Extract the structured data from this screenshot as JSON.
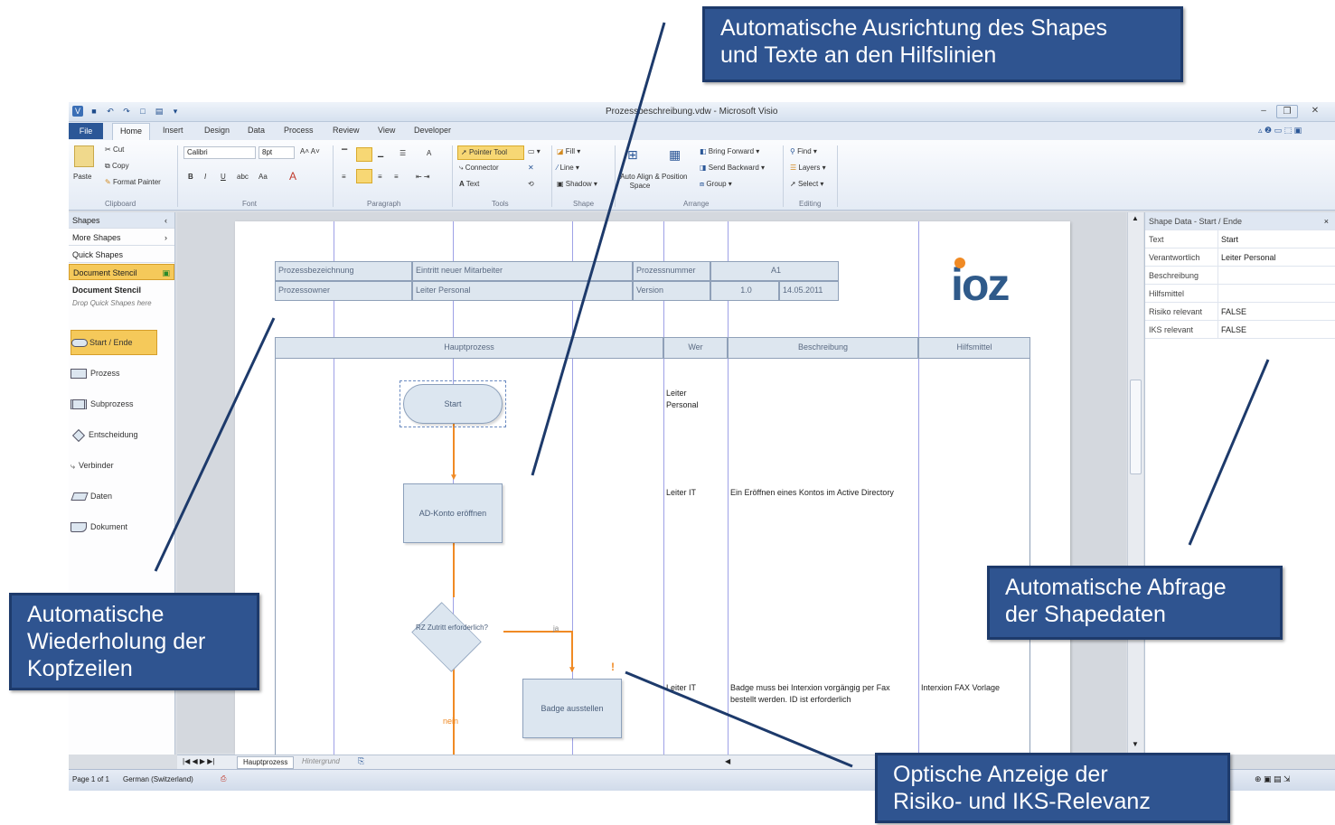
{
  "window": {
    "title": "Prozessbeschreibung.vdw - Microsoft Visio"
  },
  "menu": {
    "file": "File",
    "tabs": [
      "Home",
      "Insert",
      "Design",
      "Data",
      "Process",
      "Review",
      "View",
      "Developer"
    ]
  },
  "ribbon": {
    "clipboard": {
      "paste": "Paste",
      "cut": "Cut",
      "copy": "Copy",
      "format_painter": "Format Painter",
      "group": "Clipboard"
    },
    "font": {
      "family": "Calibri",
      "size": "8pt",
      "group": "Font"
    },
    "paragraph": {
      "group": "Paragraph"
    },
    "tools": {
      "pointer": "Pointer Tool",
      "connector": "Connector",
      "text": "Text",
      "group": "Tools"
    },
    "shape": {
      "fill": "Fill",
      "line": "Line",
      "shadow": "Shadow",
      "group": "Shape"
    },
    "arrange": {
      "auto_align": "Auto Align & Space",
      "position": "Position",
      "bring_forward": "Bring Forward",
      "send_backward": "Send Backward",
      "group_btn": "Group",
      "group": "Arrange"
    },
    "editing": {
      "find": "Find",
      "layers": "Layers",
      "select": "Select",
      "group": "Editing"
    }
  },
  "shapes_pane": {
    "title": "Shapes",
    "more_shapes": "More Shapes",
    "quick_shapes": "Quick Shapes",
    "document_stencil": "Document Stencil",
    "stencil_title": "Document Stencil",
    "stencil_hint": "Drop Quick Shapes here",
    "items": [
      "Start / Ende",
      "Prozess",
      "Subprozess",
      "Entscheidung",
      "Verbinder",
      "Daten",
      "Dokument"
    ]
  },
  "header_table": {
    "row1": [
      "Prozessbezeichnung",
      "Eintritt neuer Mitarbeiter",
      "Prozessnummer",
      "A1"
    ],
    "row2": [
      "Prozessowner",
      "Leiter Personal",
      "Version",
      "1.0",
      "14.05.2011"
    ]
  },
  "logo": "ioz",
  "columns": [
    "Hauptprozess",
    "Wer",
    "Beschreibung",
    "Hilfsmittel"
  ],
  "flow": {
    "start": "Start",
    "ad_konto": "AD-Konto eröffnen",
    "decision": "RZ Zutritt erforderlich?",
    "yes": "ja",
    "no": "nein",
    "badge": "Badge ausstellen",
    "flag": "!"
  },
  "rows": [
    {
      "wer": "Leiter Personal",
      "beschreibung": "",
      "hilfsmittel": ""
    },
    {
      "wer": "Leiter IT",
      "beschreibung": "Ein Eröffnen eines Kontos im Active Directory",
      "hilfsmittel": ""
    },
    {
      "wer": "Leiter IT",
      "beschreibung": "Badge muss bei Interxion vorgängig per Fax bestellt werden. ID ist erforderlich",
      "hilfsmittel": "Interxion FAX Vorlage"
    }
  ],
  "shape_data": {
    "title": "Shape Data - Start / Ende",
    "rows": [
      {
        "key": "Text",
        "value": "Start"
      },
      {
        "key": "Verantwortlich",
        "value": "Leiter Personal"
      },
      {
        "key": "Beschreibung",
        "value": ""
      },
      {
        "key": "Hilfsmittel",
        "value": ""
      },
      {
        "key": "Risiko relevant",
        "value": "FALSE"
      },
      {
        "key": "IKS relevant",
        "value": "FALSE"
      }
    ]
  },
  "page_tabs": [
    "Hauptprozess",
    "Hintergrund"
  ],
  "status": {
    "page": "Page 1 of 1",
    "language": "German (Switzerland)"
  },
  "callouts": {
    "top": "Automatische Ausrichtung des Shapes\nund Texte an den Hilfslinien",
    "left": "Automatische\nWiederholung der\nKopfzeilen",
    "right": "Automatische Abfrage\nder Shapedaten",
    "bottom": "Optische Anzeige der\nRisiko- und IKS-Relevanz"
  },
  "colors": {
    "callout_bg": "#2f5490",
    "flow_line": "#f08a24",
    "guide": "#6a6fd8",
    "logo": "#2f5a8a"
  }
}
